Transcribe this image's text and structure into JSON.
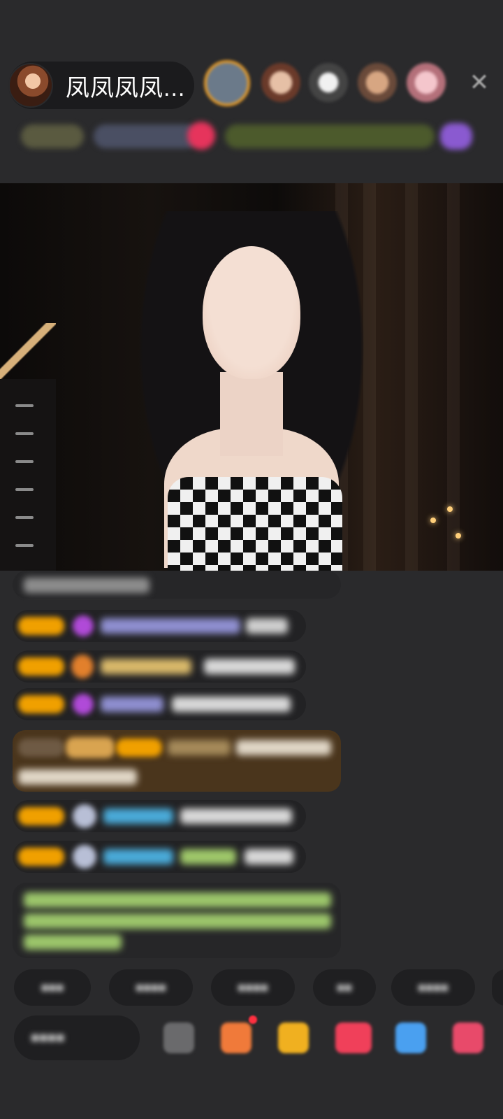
{
  "header": {
    "host_name": "凤凤凤凤...",
    "close_symbol": "✕"
  },
  "icons": {
    "host_avatar": "avatar",
    "close": "close-icon"
  },
  "input": {
    "placeholder": ""
  }
}
